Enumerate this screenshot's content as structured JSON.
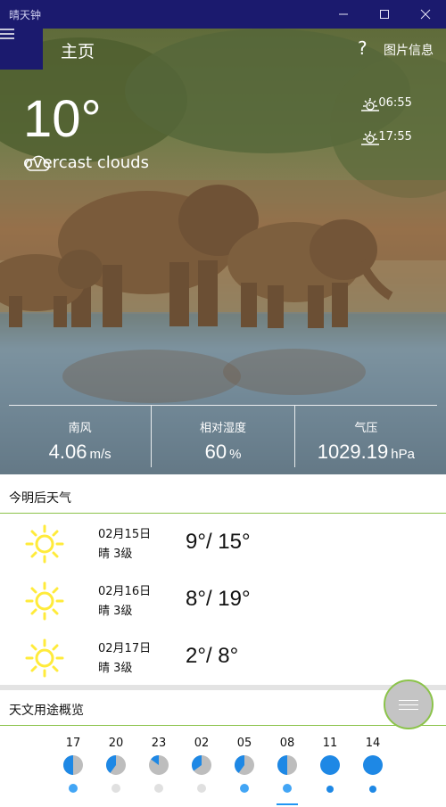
{
  "window": {
    "title": "晴天钟"
  },
  "header": {
    "page_title": "主页",
    "help_icon": "?",
    "image_info_label": "图片信息"
  },
  "current": {
    "temperature": "10°",
    "condition": "overcast clouds",
    "sunrise": "06:55",
    "sunset": "17:55",
    "time_separator": ":"
  },
  "stats": [
    {
      "label": "南风",
      "value": "4.06",
      "unit": "m/s"
    },
    {
      "label": "相对湿度",
      "value": "60",
      "unit": "%"
    },
    {
      "label": "气压",
      "value": "1029.19",
      "unit": "hPa"
    }
  ],
  "forecast": {
    "title": "今明后天气",
    "days": [
      {
        "date": "02月15日",
        "desc": "晴 3级",
        "range": "9°/ 15°"
      },
      {
        "date": "02月16日",
        "desc": "晴 3级",
        "range": "8°/ 19°"
      },
      {
        "date": "02月17日",
        "desc": "晴 3级",
        "range": "2°/ 8°"
      }
    ]
  },
  "astronomy": {
    "title": "天文用途概览",
    "hours": [
      "17",
      "20",
      "23",
      "02",
      "05",
      "08",
      "11",
      "14"
    ],
    "cloud_fraction": [
      0.5,
      0.4,
      0.15,
      0.35,
      0.4,
      0.5,
      1.0,
      1.0
    ],
    "dot_colors": [
      "#42a5f5",
      "#e0e0e0",
      "#e0e0e0",
      "#e0e0e0",
      "#42a5f5",
      "#42a5f5",
      "#1e88e5",
      "#1e88e5"
    ],
    "dot_sizes": [
      "normal",
      "normal",
      "normal",
      "normal",
      "normal",
      "normal",
      "small",
      "small"
    ]
  },
  "colors": {
    "accent": "#8bc34a",
    "titlebar": "#1b1a6e",
    "sun": "#ffeb3b",
    "pie_fill": "#1e88e5",
    "pie_bg": "#bdbdbd"
  },
  "icons": [
    "hamburger-icon",
    "help-icon",
    "cloud-icon",
    "sunrise-icon",
    "sunset-icon",
    "sun-icon",
    "minimize-icon",
    "maximize-icon",
    "close-icon",
    "menu-icon"
  ]
}
